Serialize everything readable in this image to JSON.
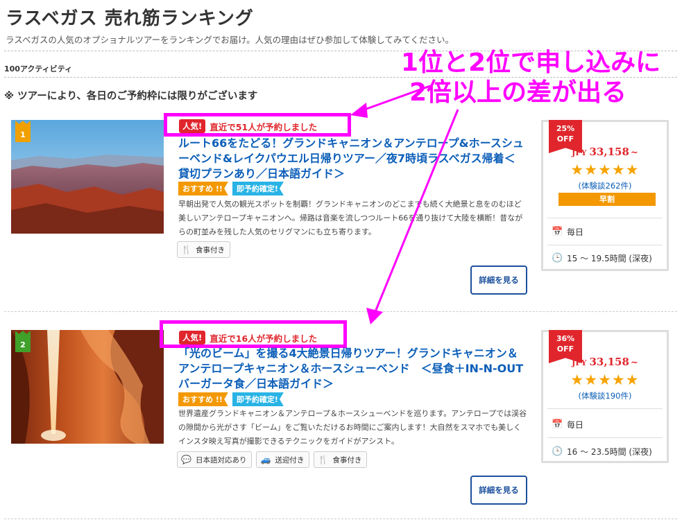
{
  "header": {
    "title": "ラスベガス 売れ筋ランキング",
    "description": "ラスベガスの人気のオプショナルツアーをランキングでお届け。人気の理由はぜひ参加して体験してみてください。",
    "activity_count": "100アクティビティ",
    "notice": "※ ツアーにより、各日のご予約枠には限りがございます"
  },
  "annotation": {
    "line1": "1位と2位で申し込みに",
    "line2": "2倍以上の差が出る",
    "color": "#ff00ff"
  },
  "tours": [
    {
      "rank": "1",
      "popular_tag": "人気!",
      "popular_text": "直近で51人が予約しました",
      "title": "ルート66をたどる！グランドキャニオン＆アンテロープ&ホースシューベンド&レイクパウエル日帰りツアー／夜7時頃ラスベガス帰着＜貸切プランあり／日本語ガイド＞",
      "tags": [
        "おすすめ !!",
        "即予約確定!"
      ],
      "description": "早朝出発で人気の観光スポットを制覇！グランドキャニオンのどこまでも続く大絶景と息をのむほど美しいアンテロープキャニオンへ。帰路は音楽を流しつつルート66を通り抜けて大陸を横断！昔ながらの町並みを残した人気のセリグマンにも立ち寄ります。",
      "features": [
        "食事付き"
      ],
      "detail_label": "詳細を見る",
      "discount_pct": "25%",
      "discount_off": "OFF",
      "currency": "JPY",
      "price": "33,158",
      "price_suffix": "~",
      "rating_stars": "★★★★★",
      "reviews": "(体験談262件)",
      "early_bird": "早割",
      "schedule": "毎日",
      "duration": "15 〜 19.5時間 (深夜)"
    },
    {
      "rank": "2",
      "popular_tag": "人気!",
      "popular_text": "直近で16人が予約しました",
      "title": "「光のビーム」を撮る4大絶景日帰りツアー！グランドキャニオン＆アンテロープキャニオン＆ホースシューベンド　＜昼食＋IN-N-OUTバーガータ食／日本語ガイド＞",
      "tags": [
        "おすすめ !!",
        "即予約確定!"
      ],
      "description": "世界遺産グランドキャニオン＆アンテロープ＆ホースシューベンドを巡ります。アンテロープでは渓谷の隙間から光がさす「ビーム」をご覧いただけるお時間にご案内します！大自然をスマホでも美しくインスタ映え写真が撮影できるテクニックをガイドがアシスト。",
      "features": [
        "日本語対応あり",
        "送迎付き",
        "食事付き"
      ],
      "detail_label": "詳細を見る",
      "discount_pct": "36%",
      "discount_off": "OFF",
      "currency": "JPY",
      "price": "33,158",
      "price_suffix": "~",
      "rating_stars": "★★★★★",
      "reviews": "(体験談190件)",
      "schedule": "毎日",
      "duration": "16 〜 23.5時間 (深夜)"
    }
  ],
  "icons": {
    "calendar": "calendar-icon",
    "clock": "clock-icon",
    "meal": "fork-knife-icon",
    "language": "speech-bubble-icon",
    "transfer": "car-icon"
  }
}
